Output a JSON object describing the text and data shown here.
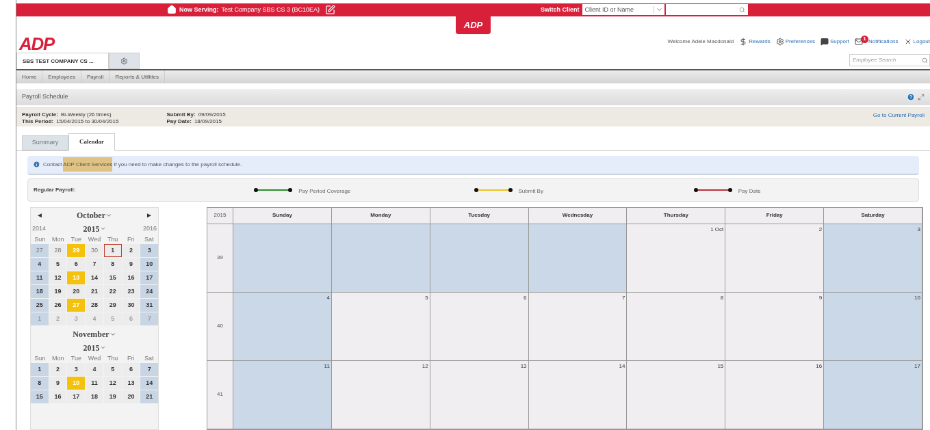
{
  "top_bar": {
    "now_serving_label": "Now Serving:",
    "now_serving_value": "Test Company SBS CS 3 (BC10EA)",
    "switch_client_label": "Switch Client",
    "client_select": {
      "placeholder": "Client ID or Name"
    }
  },
  "logo_tab": "ADP",
  "logo": "ADP",
  "user_bar": {
    "welcome": "Welcome Adele Macdonald",
    "links": [
      {
        "kind": "dollar",
        "label": "Rewards"
      },
      {
        "kind": "gear",
        "label": "Preferences"
      },
      {
        "kind": "chat",
        "label": "Support"
      },
      {
        "kind": "mail",
        "label": "Notifications",
        "badge": "1"
      },
      {
        "kind": "close",
        "label": "Logout"
      }
    ]
  },
  "company_tab": {
    "label": "SBS TEST COMPANY CS ..."
  },
  "employee_search": {
    "placeholder": "Employee Search"
  },
  "nav": [
    "Home",
    "Employees",
    "Payroll",
    "Reports & Utilities"
  ],
  "panel": {
    "title": "Payroll Schedule",
    "details": [
      {
        "label": "Payroll Cycle:",
        "value": "Bi-Weekly (26 times)"
      },
      {
        "label": "This Period:",
        "value": "15/04/2015 to 30/04/2015"
      },
      {
        "label": "Submit By:",
        "value": "09/09/2015"
      },
      {
        "label": "Pay Date:",
        "value": "18/09/2015"
      }
    ],
    "current_link": "Go to Current Payroll",
    "tabs": [
      {
        "label": "Summary",
        "selected": false
      },
      {
        "label": "Calendar",
        "selected": true
      }
    ],
    "alert": {
      "before": "Contact",
      "link": "ADP Client Services",
      "after": "if you need to make changes to the payroll schedule."
    },
    "legend": {
      "label": "Regular Payroll:",
      "items": [
        {
          "label": "Pay Period Coverage",
          "color": "#2e8b2e"
        },
        {
          "label": "Submit By",
          "color": "#f0c419"
        },
        {
          "label": "Pay Date",
          "color": "#b8333a"
        }
      ]
    }
  },
  "mini_calendars": [
    {
      "prev": "◄",
      "next": "►",
      "month": "October",
      "year": "2015",
      "prev_year": "2014",
      "next_year": "2016",
      "weekdays": [
        "Sun",
        "Mon",
        "Tue",
        "Wed",
        "Thu",
        "Fri",
        "Sat"
      ],
      "weeks": [
        [
          {
            "day": "27",
            "muted": true,
            "highlighted": false,
            "selected": false
          },
          {
            "day": "28",
            "muted": true,
            "highlighted": false,
            "selected": false
          },
          {
            "day": "29",
            "muted": false,
            "highlighted": true,
            "selected": false
          },
          {
            "day": "30",
            "muted": true,
            "highlighted": false,
            "selected": false
          },
          {
            "day": "1",
            "muted": false,
            "highlighted": false,
            "selected": true
          },
          {
            "day": "2",
            "muted": false,
            "highlighted": false,
            "selected": false
          },
          {
            "day": "3",
            "muted": false,
            "highlighted": false,
            "selected": false
          }
        ],
        [
          {
            "day": "4",
            "muted": false,
            "highlighted": false,
            "selected": false
          },
          {
            "day": "5",
            "muted": false,
            "highlighted": false,
            "selected": false
          },
          {
            "day": "6",
            "muted": false,
            "highlighted": false,
            "selected": false
          },
          {
            "day": "7",
            "muted": false,
            "highlighted": false,
            "selected": false
          },
          {
            "day": "8",
            "muted": false,
            "highlighted": false,
            "selected": false
          },
          {
            "day": "9",
            "muted": false,
            "highlighted": false,
            "selected": false
          },
          {
            "day": "10",
            "muted": false,
            "highlighted": false,
            "selected": false
          }
        ],
        [
          {
            "day": "11",
            "muted": false,
            "highlighted": false,
            "selected": false
          },
          {
            "day": "12",
            "muted": false,
            "highlighted": false,
            "selected": false
          },
          {
            "day": "13",
            "muted": false,
            "highlighted": true,
            "selected": false
          },
          {
            "day": "14",
            "muted": false,
            "highlighted": false,
            "selected": false
          },
          {
            "day": "15",
            "muted": false,
            "highlighted": false,
            "selected": false
          },
          {
            "day": "16",
            "muted": false,
            "highlighted": false,
            "selected": false
          },
          {
            "day": "17",
            "muted": false,
            "highlighted": false,
            "selected": false
          }
        ],
        [
          {
            "day": "18",
            "muted": false,
            "highlighted": false,
            "selected": false
          },
          {
            "day": "19",
            "muted": false,
            "highlighted": false,
            "selected": false
          },
          {
            "day": "20",
            "muted": false,
            "highlighted": false,
            "selected": false
          },
          {
            "day": "21",
            "muted": false,
            "highlighted": false,
            "selected": false
          },
          {
            "day": "22",
            "muted": false,
            "highlighted": false,
            "selected": false
          },
          {
            "day": "23",
            "muted": false,
            "highlighted": false,
            "selected": false
          },
          {
            "day": "24",
            "muted": false,
            "highlighted": false,
            "selected": false
          }
        ],
        [
          {
            "day": "25",
            "muted": false,
            "highlighted": false,
            "selected": false
          },
          {
            "day": "26",
            "muted": false,
            "highlighted": false,
            "selected": false
          },
          {
            "day": "27",
            "muted": false,
            "highlighted": true,
            "selected": false
          },
          {
            "day": "28",
            "muted": false,
            "highlighted": false,
            "selected": false
          },
          {
            "day": "29",
            "muted": false,
            "highlighted": false,
            "selected": false
          },
          {
            "day": "30",
            "muted": false,
            "highlighted": false,
            "selected": false
          },
          {
            "day": "31",
            "muted": false,
            "highlighted": false,
            "selected": false
          }
        ],
        [
          {
            "day": "1",
            "muted": true,
            "highlighted": false,
            "selected": false
          },
          {
            "day": "2",
            "muted": true,
            "highlighted": false,
            "selected": false
          },
          {
            "day": "3",
            "muted": true,
            "highlighted": false,
            "selected": false
          },
          {
            "day": "4",
            "muted": true,
            "highlighted": false,
            "selected": false
          },
          {
            "day": "5",
            "muted": true,
            "highlighted": false,
            "selected": false
          },
          {
            "day": "6",
            "muted": true,
            "highlighted": false,
            "selected": false
          },
          {
            "day": "7",
            "muted": true,
            "highlighted": false,
            "selected": false
          }
        ]
      ]
    },
    {
      "month": "November",
      "year": "2015",
      "weekdays": [
        "Sun",
        "Mon",
        "Tue",
        "Wed",
        "Thu",
        "Fri",
        "Sat"
      ],
      "weeks": [
        [
          {
            "day": "1",
            "muted": false,
            "highlighted": false,
            "selected": false
          },
          {
            "day": "2",
            "muted": false,
            "highlighted": false,
            "selected": false
          },
          {
            "day": "3",
            "muted": false,
            "highlighted": false,
            "selected": false
          },
          {
            "day": "4",
            "muted": false,
            "highlighted": false,
            "selected": false
          },
          {
            "day": "5",
            "muted": false,
            "highlighted": false,
            "selected": false
          },
          {
            "day": "6",
            "muted": false,
            "highlighted": false,
            "selected": false
          },
          {
            "day": "7",
            "muted": false,
            "highlighted": false,
            "selected": false
          }
        ],
        [
          {
            "day": "8",
            "muted": false,
            "highlighted": false,
            "selected": false
          },
          {
            "day": "9",
            "muted": false,
            "highlighted": false,
            "selected": false
          },
          {
            "day": "10",
            "muted": false,
            "highlighted": true,
            "selected": false
          },
          {
            "day": "11",
            "muted": false,
            "highlighted": false,
            "selected": false
          },
          {
            "day": "12",
            "muted": false,
            "highlighted": false,
            "selected": false
          },
          {
            "day": "13",
            "muted": false,
            "highlighted": false,
            "selected": false
          },
          {
            "day": "14",
            "muted": false,
            "highlighted": false,
            "selected": false
          }
        ],
        [
          {
            "day": "15",
            "muted": false,
            "highlighted": false,
            "selected": false
          },
          {
            "day": "16",
            "muted": false,
            "highlighted": false,
            "selected": false
          },
          {
            "day": "17",
            "muted": false,
            "highlighted": false,
            "selected": false
          },
          {
            "day": "18",
            "muted": false,
            "highlighted": false,
            "selected": false
          },
          {
            "day": "19",
            "muted": false,
            "highlighted": false,
            "selected": false
          },
          {
            "day": "20",
            "muted": false,
            "highlighted": false,
            "selected": false
          },
          {
            "day": "21",
            "muted": false,
            "highlighted": false,
            "selected": false
          }
        ]
      ]
    }
  ],
  "big_calendar": {
    "year": "2015",
    "columns": [
      "Sunday",
      "Monday",
      "Tuesday",
      "Wednesday",
      "Thursday",
      "Friday",
      "Saturday"
    ],
    "weeks": [
      {
        "week": "39",
        "days": [
          {
            "shaded": true
          },
          {
            "shaded": true
          },
          {
            "shaded": true
          },
          {
            "shaded": true
          },
          {
            "label": "1 Oct",
            "shaded": false
          },
          {
            "label": "2",
            "shaded": false
          },
          {
            "label": "3",
            "shaded": true
          }
        ]
      },
      {
        "week": "40",
        "days": [
          {
            "label": "4",
            "shaded": true
          },
          {
            "label": "5",
            "shaded": false
          },
          {
            "label": "6",
            "shaded": false
          },
          {
            "label": "7",
            "shaded": false
          },
          {
            "label": "8",
            "shaded": false
          },
          {
            "label": "9",
            "shaded": false
          },
          {
            "label": "10",
            "shaded": true
          }
        ]
      },
      {
        "week": "41",
        "days": [
          {
            "label": "11",
            "shaded": true
          },
          {
            "label": "12",
            "shaded": false
          },
          {
            "label": "13",
            "shaded": false
          },
          {
            "label": "14",
            "shaded": false
          },
          {
            "label": "15",
            "shaded": false
          },
          {
            "label": "16",
            "shaded": false
          },
          {
            "label": "17",
            "shaded": true
          }
        ]
      }
    ]
  }
}
